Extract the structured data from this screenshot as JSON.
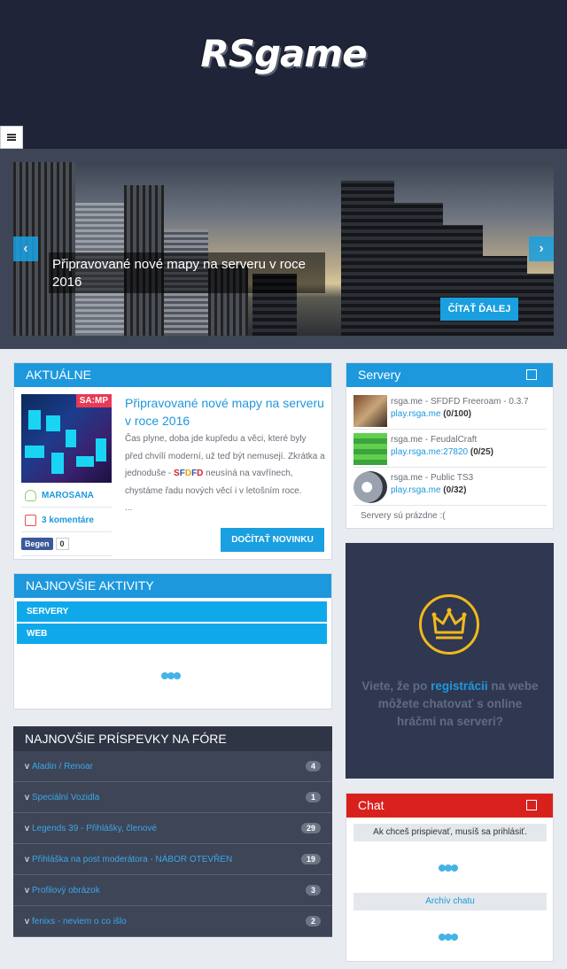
{
  "header": {
    "logo": "RSgame"
  },
  "hero": {
    "caption": "Připravované nové mapy na serveru v roce 2016",
    "read_more": "ČÍTAŤ ĎALEJ",
    "prev": "‹",
    "next": "›"
  },
  "news": {
    "title": "AKTUÁLNE",
    "image_tag": "SA:MP",
    "item_title": "Připravované nové mapy na serveru v roce 2016",
    "text_before": "Čas plyne, doba jde kupředu a věci, které byly před chvílí moderní, už teď být nemusejí. Zkrátka a jednoduše - ",
    "brand_letters": [
      "S",
      "F",
      "D",
      "F",
      "D"
    ],
    "text_after": " neusíná na vavřínech, chystáme řadu nových věcí i v letošním roce.",
    "ellipsis": "...",
    "author": "MAROSANA",
    "comments": "3 komentáre",
    "fb_label": "Begen",
    "fb_count": "0",
    "read_button": "DOČÍTAŤ NOVINKU"
  },
  "activity": {
    "title": "NAJNOVŠIE AKTIVITY",
    "tabs": [
      "SERVERY",
      "WEB"
    ]
  },
  "forum": {
    "title": "NAJNOVŠIE PRÍSPEVKY NA FÓRE",
    "prefix": "v",
    "items": [
      {
        "label": "Aladin / Renoar",
        "count": "4"
      },
      {
        "label": "Speciální Vozidla",
        "count": "1"
      },
      {
        "label": "Legends 39 - Přihlášky, členové",
        "count": "29"
      },
      {
        "label": "Přihláška na post moderátora - NÁBOR OTEVŘEN",
        "count": "19"
      },
      {
        "label": "Profilový obrázok",
        "count": "3"
      },
      {
        "label": "fenixs - neviem o co išlo",
        "count": "2"
      }
    ]
  },
  "servers": {
    "title": "Servery",
    "items": [
      {
        "name": "rsga.me - SFDFD Freeroam - 0.3.7",
        "address": "play.rsga.me",
        "players": "(0/100)"
      },
      {
        "name": "rsga.me - FeudalCraft",
        "address": "play.rsga.me:27820",
        "players": "(0/25)"
      },
      {
        "name": "rsga.me - Public TS3",
        "address": "play.rsga.me",
        "players": "(0/32)"
      }
    ],
    "empty": "Servery sú prázdne :("
  },
  "promo": {
    "text_before": "Viete, že po ",
    "link": "registrácii",
    "text_after": " na webe môžete chatovať s online hráčmi na serveri?"
  },
  "chat": {
    "title": "Chat",
    "note": "Ak chceš prispievať, musíš sa prihlásiť.",
    "archive": "Archív chatu"
  },
  "colors": {
    "accent": "#1d98dd",
    "header_bg": "#1f2438",
    "chat_red": "#d8211d"
  }
}
